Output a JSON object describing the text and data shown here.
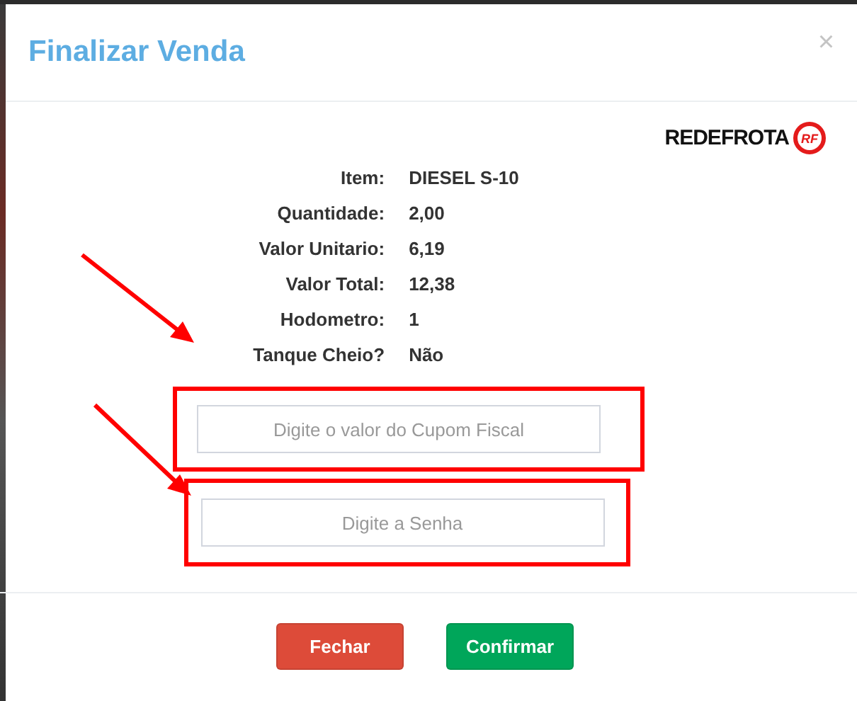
{
  "dialog": {
    "title": "Finalizar Venda",
    "close": "×"
  },
  "logo": {
    "name": "REDEFROTA",
    "mark": "RF"
  },
  "details": [
    {
      "label": "Item:",
      "value": "DIESEL S-10"
    },
    {
      "label": "Quantidade:",
      "value": "2,00"
    },
    {
      "label": "Valor Unitario:",
      "value": "6,19"
    },
    {
      "label": "Valor Total:",
      "value": "12,38"
    },
    {
      "label": "Hodometro:",
      "value": "1"
    },
    {
      "label": "Tanque Cheio?",
      "value": "Não"
    }
  ],
  "fields": [
    {
      "placeholder": "Digite o valor do Cupom Fiscal"
    },
    {
      "placeholder": "Digite a Senha"
    }
  ],
  "buttons": [
    {
      "label": "Fechar",
      "kind": "danger"
    },
    {
      "label": "Confirmar",
      "kind": "success"
    }
  ]
}
